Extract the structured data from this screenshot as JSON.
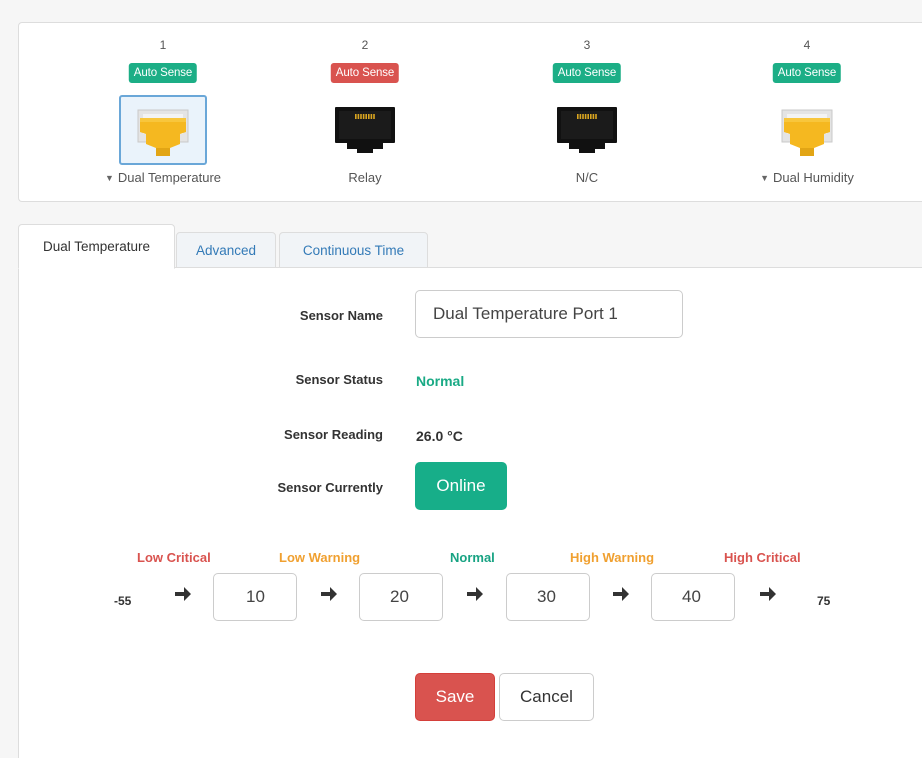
{
  "ports": [
    {
      "number": "1",
      "badge": "Auto Sense",
      "badge_color": "#1cae86",
      "icon": "rj45-yellow-connector-icon",
      "label": "Dual Temperature",
      "has_caret": true,
      "selected": true
    },
    {
      "number": "2",
      "badge": "Auto Sense",
      "badge_color": "#d9534f",
      "icon": "rj45-black-port-icon",
      "label": "Relay",
      "has_caret": false,
      "selected": false
    },
    {
      "number": "3",
      "badge": "Auto Sense",
      "badge_color": "#1cae86",
      "icon": "rj45-black-port-icon",
      "label": "N/C",
      "has_caret": false,
      "selected": false
    },
    {
      "number": "4",
      "badge": "Auto Sense",
      "badge_color": "#1cae86",
      "icon": "rj45-yellow-connector-icon",
      "label": "Dual Humidity",
      "has_caret": true,
      "selected": false
    }
  ],
  "tabs": [
    {
      "label": "Dual Temperature",
      "active": true
    },
    {
      "label": "Advanced",
      "active": false
    },
    {
      "label": "Continuous Time",
      "active": false
    }
  ],
  "form": {
    "sensor_name_label": "Sensor Name",
    "sensor_name_value": "Dual Temperature Port 1",
    "sensor_status_label": "Sensor Status",
    "sensor_status_value": "Normal",
    "sensor_reading_label": "Sensor Reading",
    "sensor_reading_value": "26.0 °C",
    "sensor_currently_label": "Sensor Currently",
    "sensor_currently_value": "Online"
  },
  "thresholds": {
    "labels": {
      "low_critical": "Low Critical",
      "low_warning": "Low Warning",
      "normal": "Normal",
      "high_warning": "High Warning",
      "high_critical": "High Critical"
    },
    "min": "-55",
    "max": "75",
    "values": [
      "10",
      "20",
      "30",
      "40"
    ]
  },
  "actions": {
    "save": "Save",
    "cancel": "Cancel"
  },
  "colors": {
    "green": "#1cae86",
    "red": "#d9534f",
    "orange": "#f0a030",
    "link_blue": "#337ab7"
  }
}
